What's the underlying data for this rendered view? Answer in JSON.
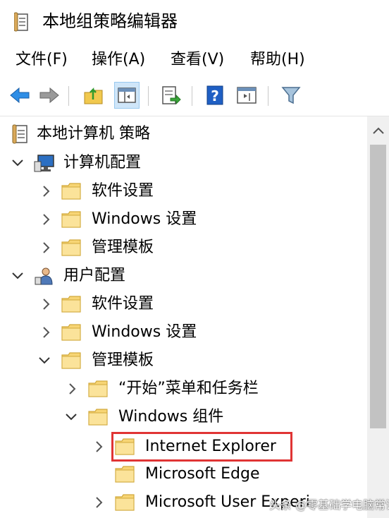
{
  "window": {
    "title": "本地组策略编辑器"
  },
  "menu": [
    "文件(F)",
    "操作(A)",
    "查看(V)",
    "帮助(H)"
  ],
  "toolbar": {
    "buttons": [
      "back-arrow-icon",
      "forward-arrow-icon",
      "up-folder-icon",
      "show-hide-tree-icon",
      "export-list-icon",
      "help-icon",
      "properties-icon",
      "filter-icon"
    ]
  },
  "tree": {
    "root": "本地计算机 策略",
    "computer_config": {
      "label": "计算机配置",
      "children": [
        "软件设置",
        "Windows 设置",
        "管理模板"
      ]
    },
    "user_config": {
      "label": "用户配置",
      "children": [
        "软件设置",
        "Windows 设置",
        "管理模板"
      ],
      "admin_templates_children": [
        "“开始”菜单和任务栏",
        "Windows 组件"
      ],
      "windows_components_children": [
        "Internet Explorer",
        "Microsoft Edge",
        "Microsoft User Experi"
      ]
    }
  },
  "watermark": "头条 @零基础学电脑常识",
  "colors": {
    "highlight_border": "#e03434",
    "folder": "#f7d575",
    "accent": "#1a73c9"
  }
}
